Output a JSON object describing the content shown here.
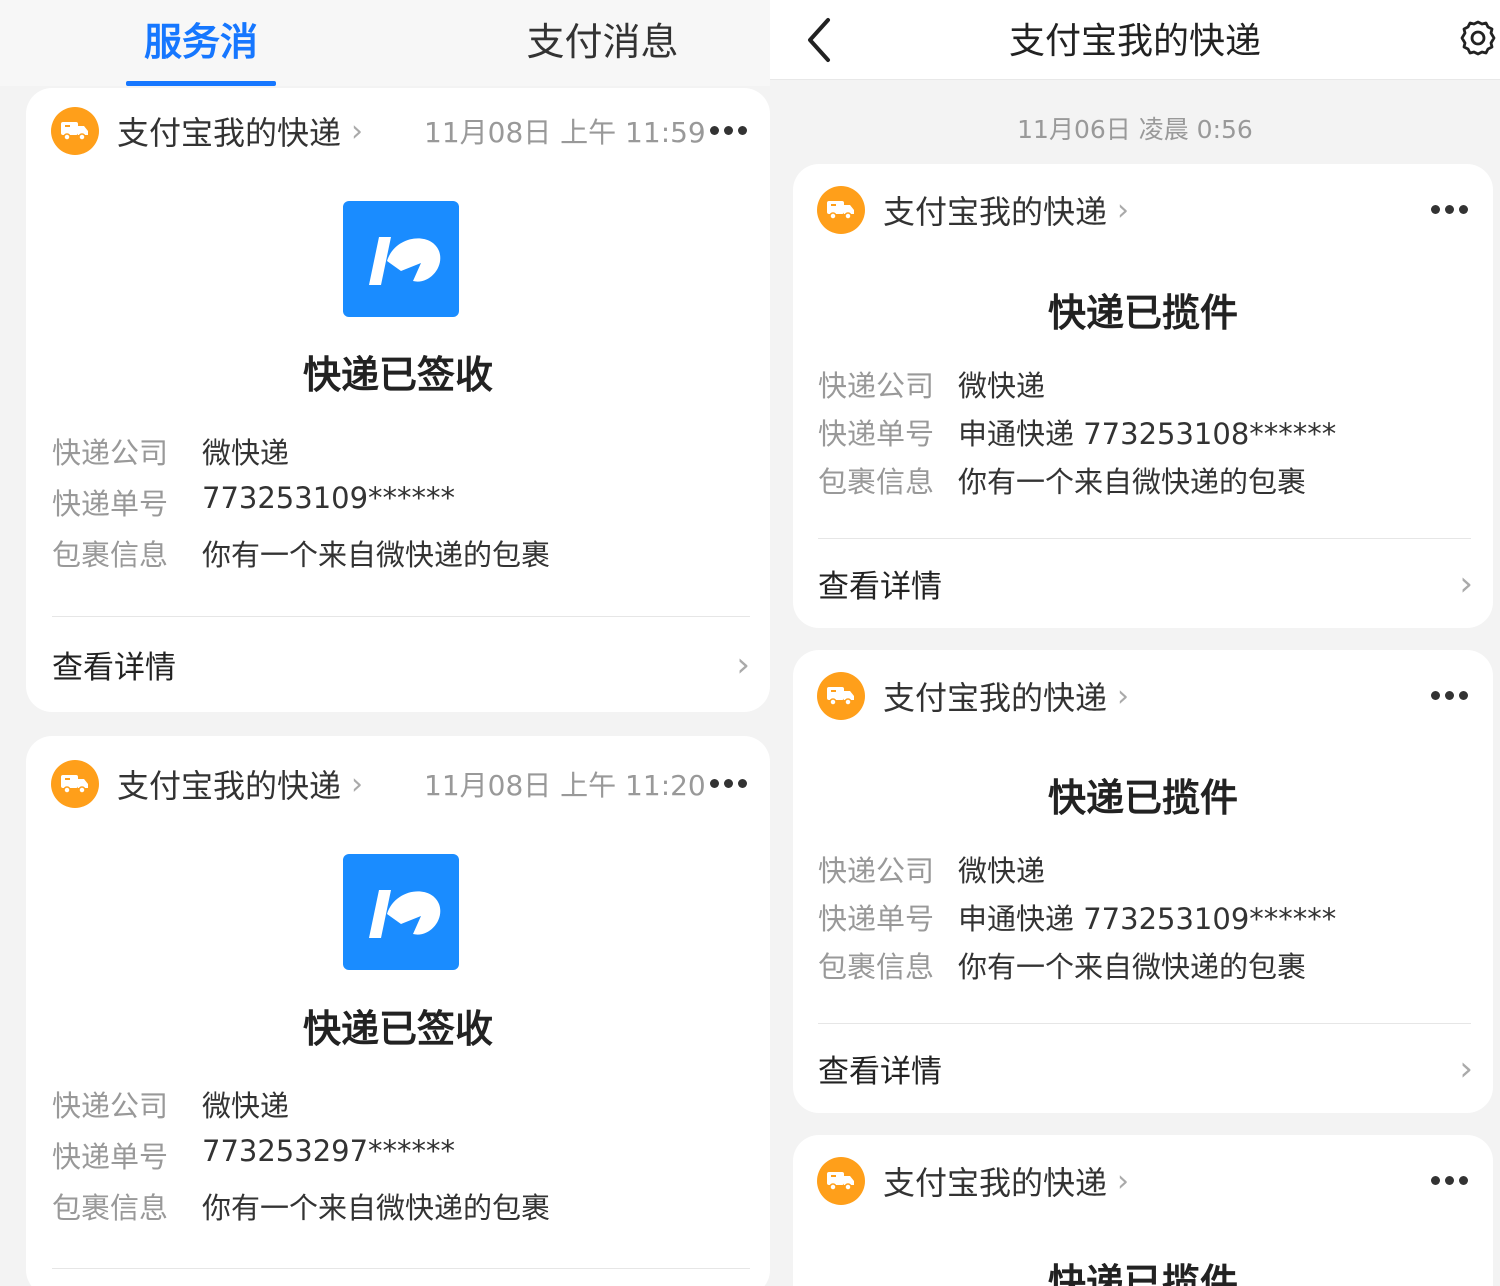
{
  "tabs": {
    "service": "服务消息",
    "payment": "支付消息"
  },
  "navbar": {
    "title": "支付宝我的快递"
  },
  "date_separator": "11月06日 凌晨 0:56",
  "left_cards": [
    {
      "sender": "支付宝我的快递",
      "time": "11月08日 上午 11:59",
      "title": "快递已签收",
      "rows": [
        {
          "k": "快递公司",
          "v": "微快递"
        },
        {
          "k": "快递单号",
          "v": "773253109******"
        },
        {
          "k": "包裹信息",
          "v": "你有一个来自微快递的包裹"
        }
      ],
      "detail": "查看详情"
    },
    {
      "sender": "支付宝我的快递",
      "time": "11月08日 上午 11:20",
      "title": "快递已签收",
      "rows": [
        {
          "k": "快递公司",
          "v": "微快递"
        },
        {
          "k": "快递单号",
          "v": "773253297******"
        },
        {
          "k": "包裹信息",
          "v": "你有一个来自微快递的包裹"
        }
      ]
    }
  ],
  "right_cards": [
    {
      "sender": "支付宝我的快递",
      "title": "快递已揽件",
      "rows": [
        {
          "k": "快递公司",
          "v": "微快递"
        },
        {
          "k": "快递单号",
          "v": "申通快递 773253108******"
        },
        {
          "k": "包裹信息",
          "v": "你有一个来自微快递的包裹"
        }
      ],
      "detail": "查看详情"
    },
    {
      "sender": "支付宝我的快递",
      "title": "快递已揽件",
      "rows": [
        {
          "k": "快递公司",
          "v": "微快递"
        },
        {
          "k": "快递单号",
          "v": "申通快递 773253109******"
        },
        {
          "k": "包裹信息",
          "v": "你有一个来自微快递的包裹"
        }
      ],
      "detail": "查看详情"
    },
    {
      "sender": "支付宝我的快递",
      "title": "快递已揽件"
    }
  ],
  "colors": {
    "accent": "#1677ff",
    "avatar": "#ff9f1a",
    "logo": "#1a8cff"
  },
  "icons": [
    "truck-icon",
    "chevron-right-icon",
    "more-icon",
    "back-icon",
    "gear-icon",
    "courier-logo"
  ]
}
